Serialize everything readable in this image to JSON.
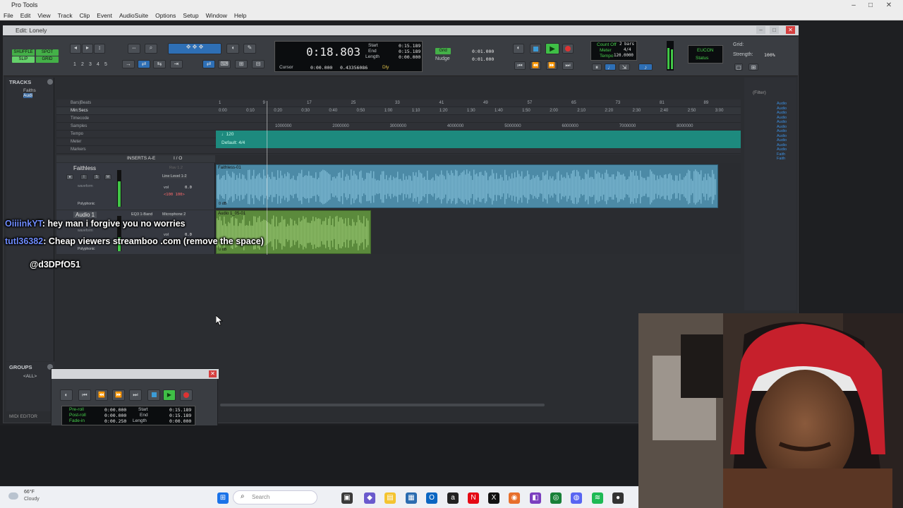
{
  "app": {
    "title": "Pro Tools"
  },
  "menu": [
    "File",
    "Edit",
    "View",
    "Track",
    "Clip",
    "Event",
    "AudioSuite",
    "Options",
    "Setup",
    "Window",
    "Help"
  ],
  "edit_window": {
    "title": "Edit: Lonely"
  },
  "toolbar": {
    "modes": [
      "SHUFFLE",
      "SPOT",
      "SLIP",
      "GRID"
    ],
    "zoom_presets": [
      "1",
      "2",
      "3",
      "4",
      "5"
    ],
    "main_counter": "0:18.803",
    "sub_counter": "0:00.000",
    "sub_counter_sel": "0.43356086",
    "cursor_label": "Cursor",
    "start_label": "Start",
    "end_label": "End",
    "length_label": "Length",
    "start_value": "0:15.189",
    "end_value": "0:15.189",
    "length_value": "0:00.000",
    "dly_label": "Dly",
    "grid_label": "Grid",
    "nudge_label": "Nudge",
    "grid_value": "0:01.000",
    "nudge_value": "0:01.000",
    "count_off": "Count Off",
    "meter_label": "Meter",
    "tempo_label": "Tempo",
    "count_bars": "2 bars",
    "meter_value": "4/4",
    "tempo_value": "120.0000",
    "eucon": "EUCON",
    "status_label": "Status",
    "grid_right": "Grid:",
    "strength_label": "Strength:",
    "strength_value": "100%"
  },
  "tracks_panel": {
    "header": "TRACKS",
    "items": [
      "Faiths",
      "Audi"
    ]
  },
  "groups_panel": {
    "header": "GROUPS",
    "items": [
      "<ALL>"
    ]
  },
  "rulers": {
    "names": [
      "Bars|Beats",
      "Min:Secs",
      "Timecode",
      "Samples",
      "Tempo",
      "Meter",
      "Markers"
    ],
    "minsec_ticks": [
      "0:00",
      "0:10",
      "0:20",
      "0:30",
      "0:40",
      "0:50",
      "1:00",
      "1:10",
      "1:20",
      "1:30",
      "1:40",
      "1:50",
      "2:00",
      "2:10",
      "2:20",
      "2:30",
      "2:40",
      "2:50",
      "3:00"
    ],
    "bar_ticks": [
      "1",
      "9",
      "17",
      "25",
      "33",
      "41",
      "49",
      "57",
      "65",
      "73",
      "81",
      "89"
    ],
    "sample_ticks": [
      "1000000",
      "2000000",
      "3000000",
      "4000000",
      "5000000",
      "6000000",
      "7000000",
      "8000000"
    ],
    "tempo_marker": "♩120",
    "meter_marker": "Default: 4/4"
  },
  "edit_header": {
    "inserts": "INSERTS A-E",
    "io": "I / O"
  },
  "tracks": [
    {
      "name": "Faithless",
      "insert": "Rav 1.2",
      "input": "Line Level 1-2",
      "vol_label": "vol",
      "vol_value": "0.0",
      "pan": "<100  100>",
      "mode": "waveform",
      "voice": "Polyphonic",
      "clip": "Faithless-01",
      "gain": "0 dB"
    },
    {
      "name": "Audio 1",
      "insert": "EQ3 1-Band",
      "input": "Microphone 2",
      "output": "Out 1-2",
      "vol_label": "vol",
      "vol_value": "0.0",
      "mode": "waveform",
      "voice": "Polyphonic",
      "clip": "Audio 1_05-01",
      "gain": "0 dB"
    }
  ],
  "chat": [
    {
      "user": "OiiiinkYT",
      "message": "hey man i forgive you no worries"
    },
    {
      "user": "tutl36382",
      "message": "Cheap viewers    streamboo .com (remove the space)"
    },
    {
      "user": "",
      "message": "@d3DPfO51"
    }
  ],
  "transport": {
    "preroll_label": "Pre-roll",
    "postroll_label": "Post-roll",
    "fadein_label": "Fade-in",
    "preroll": "0:00.000",
    "postroll": "0:00.000",
    "fadein": "0:00.250",
    "start_label": "Start",
    "end_label": "End",
    "length_label": "Length",
    "start": "0:15.189",
    "end": "0:15.189",
    "length": "0:00.000"
  },
  "midi_editor": "MIDI EDITOR",
  "clips_panel": {
    "filter": "(Filter)",
    "items": [
      "Audio",
      "Audio",
      "Audio",
      "Audio",
      "Audio",
      "Audio",
      "Audio",
      "Audio",
      "Audio",
      "Audio",
      "Audio",
      "Faith",
      "Faith"
    ]
  },
  "taskbar": {
    "weather_temp": "66°F",
    "weather_desc": "Cloudy",
    "search_placeholder": "Search"
  },
  "colors": {
    "accent_green": "#47d04b",
    "clip_blue": "#4c8aa6",
    "clip_green": "#5b8a3c",
    "tempo_teal": "#1d8a7e",
    "record_red": "#d33"
  }
}
